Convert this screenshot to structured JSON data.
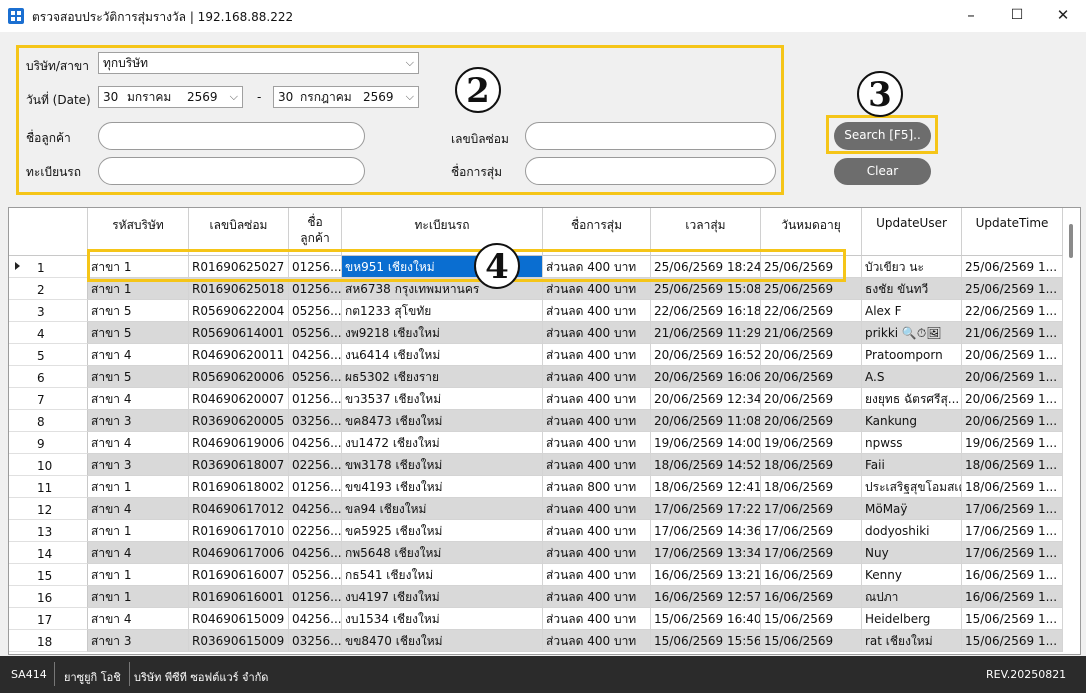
{
  "window": {
    "title": "ตรวจสอบประวัติการสุ่มรางวัล | 192.168.88.222",
    "minimize": "–",
    "maximize": "☐",
    "close": "✕"
  },
  "filters": {
    "company_label": "บริษัท/สาขา",
    "company_value": "ทุกบริษัท",
    "date_label": "วันที่ (Date)",
    "date_from": {
      "day": "30",
      "month": "มกราคม",
      "year": "2569"
    },
    "date_sep": "-",
    "date_to": {
      "day": "30",
      "month": "กรกฎาคม",
      "year": "2569"
    },
    "customer_label": "ชื่อลูกค้า",
    "plate_label": "ทะเบียนรถ",
    "bill_label": "เลขบิลซ่อม",
    "draw_label": "ชื่อการสุ่ม"
  },
  "buttons": {
    "search": "Search [F5]..",
    "clear": "Clear"
  },
  "annotations": [
    "2",
    "3",
    "4"
  ],
  "table": {
    "headers": [
      "รหัสบริษัท",
      "เลขบิลซ่อม",
      "ชื่อ\nลูกค้า",
      "ทะเบียนรถ",
      "ชื่อการสุ่ม",
      "เวลาสุ่ม",
      "วันหมดอายุ",
      "UpdateUser",
      "UpdateTime"
    ],
    "rows": [
      [
        "1",
        "สาขา 1",
        "R01690625027",
        "01256...",
        "ขห951  เชียงใหม่",
        "ส่วนลด 400 บาท",
        "25/06/2569 18:24",
        "25/06/2569",
        "บัวเขียว นะ",
        "25/06/2569 1..."
      ],
      [
        "2",
        "สาขา 1",
        "R01690625018",
        "01256...",
        "สห6738  กรุงเทพมหานคร",
        "ส่วนลด 400 บาท",
        "25/06/2569 15:08",
        "25/06/2569",
        "ธงชัย ขันทวี",
        "25/06/2569 1..."
      ],
      [
        "3",
        "สาขา 5",
        "R05690622004",
        "05256...",
        "กต1233  สุโขทัย",
        "ส่วนลด 400 บาท",
        "22/06/2569 16:18",
        "22/06/2569",
        "Alex F",
        "22/06/2569 1..."
      ],
      [
        "4",
        "สาขา 5",
        "R05690614001",
        "05256...",
        "งพ9218  เชียงใหม่",
        "ส่วนลด 400 บาท",
        "21/06/2569 11:29",
        "21/06/2569",
        "prikki 🔍⏱🖼",
        "21/06/2569 1..."
      ],
      [
        "5",
        "สาขา 4",
        "R04690620011",
        "04256...",
        "งน6414  เชียงใหม่",
        "ส่วนลด 400 บาท",
        "20/06/2569 16:52",
        "20/06/2569",
        "Pratoomporn",
        "20/06/2569 1..."
      ],
      [
        "6",
        "สาขา 5",
        "R05690620006",
        "05256...",
        "ผธ5302  เชียงราย",
        "ส่วนลด 400 บาท",
        "20/06/2569 16:06",
        "20/06/2569",
        "A.S",
        "20/06/2569 1..."
      ],
      [
        "7",
        "สาขา 4",
        "R04690620007",
        "01256...",
        "ขว3537  เชียงใหม่",
        "ส่วนลด 400 บาท",
        "20/06/2569 12:34",
        "20/06/2569",
        "ยงยุทธ ฉัตรศรีสุ...",
        "20/06/2569 1..."
      ],
      [
        "8",
        "สาขา 3",
        "R03690620005",
        "03256...",
        "ขค8473  เชียงใหม่",
        "ส่วนลด 400 บาท",
        "20/06/2569 11:08",
        "20/06/2569",
        "Kankung",
        "20/06/2569 1..."
      ],
      [
        "9",
        "สาขา 4",
        "R04690619006",
        "04256...",
        "งบ1472  เชียงใหม่",
        "ส่วนลด 400 บาท",
        "19/06/2569 14:00",
        "19/06/2569",
        "npwss",
        "19/06/2569 1..."
      ],
      [
        "10",
        "สาขา 3",
        "R03690618007",
        "02256...",
        "ขพ3178  เชียงใหม่",
        "ส่วนลด 400 บาท",
        "18/06/2569 14:52",
        "18/06/2569",
        "Faii",
        "18/06/2569 1..."
      ],
      [
        "11",
        "สาขา 1",
        "R01690618002",
        "01256...",
        "ขข4193  เชียงใหม่",
        "ส่วนลด 800 บาท",
        "18/06/2569 12:41",
        "18/06/2569",
        "ประเสริฐสุขโอมสเต",
        "18/06/2569 1..."
      ],
      [
        "12",
        "สาขา 4",
        "R04690617012",
        "04256...",
        "ขล94  เชียงใหม่",
        "ส่วนลด 400 บาท",
        "17/06/2569 17:22",
        "17/06/2569",
        "MöMaÿ",
        "17/06/2569 1..."
      ],
      [
        "13",
        "สาขา 1",
        "R01690617010",
        "02256...",
        "ขค5925  เชียงใหม่",
        "ส่วนลด 400 บาท",
        "17/06/2569 14:36",
        "17/06/2569",
        "dodyoshiki",
        "17/06/2569 1..."
      ],
      [
        "14",
        "สาขา 4",
        "R04690617006",
        "04256...",
        "กพ5648  เชียงใหม่",
        "ส่วนลด 400 บาท",
        "17/06/2569 13:34",
        "17/06/2569",
        "Nuy",
        "17/06/2569 1..."
      ],
      [
        "15",
        "สาขา 1",
        "R01690616007",
        "05256...",
        "กธ541  เชียงใหม่",
        "ส่วนลด 400 บาท",
        "16/06/2569 13:21",
        "16/06/2569",
        "Kenny",
        "16/06/2569 1..."
      ],
      [
        "16",
        "สาขา 1",
        "R01690616001",
        "01256...",
        "งบ4197  เชียงใหม่",
        "ส่วนลด 400 บาท",
        "16/06/2569 12:57",
        "16/06/2569",
        "ณปภา",
        "16/06/2569 1..."
      ],
      [
        "17",
        "สาขา 4",
        "R04690615009",
        "04256...",
        "งบ1534  เชียงใหม่",
        "ส่วนลด 400 บาท",
        "15/06/2569 16:40",
        "15/06/2569",
        "Heidelberg",
        "15/06/2569 1..."
      ],
      [
        "18",
        "สาขา 3",
        "R03690615009",
        "03256...",
        "ขข8470  เชียงใหม่",
        "ส่วนลด 400 บาท",
        "15/06/2569 15:56",
        "15/06/2569",
        "rat  เชียงใหม่",
        "15/06/2569 1..."
      ]
    ]
  },
  "status": {
    "code": "SA414",
    "user": "ยาซูยูกิ  โอชิ",
    "company": "บริษัท พีซีที ซอฟต์แวร์ จำกัด",
    "rev": "REV.20250821"
  },
  "colors": {
    "highlight": "#f5c518",
    "selected_cell": "#0a6ed1",
    "alt_row": "#d9d9d9"
  }
}
